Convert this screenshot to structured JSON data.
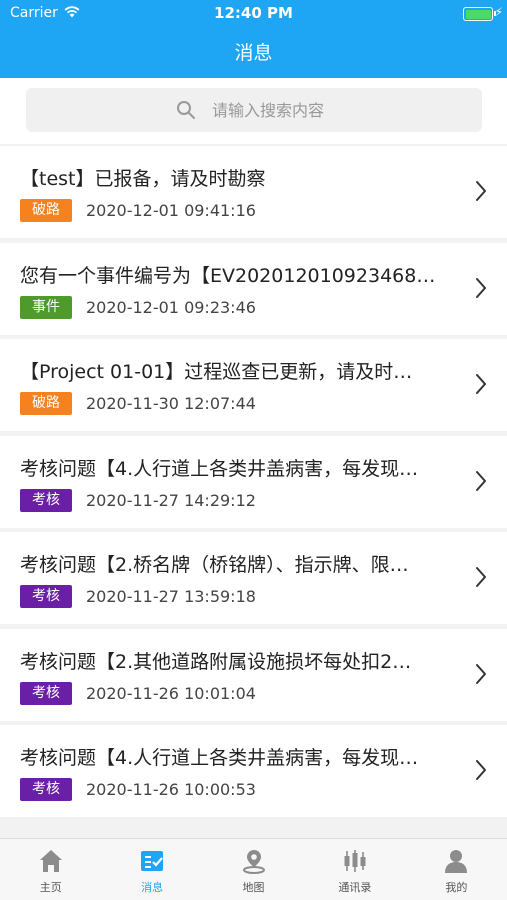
{
  "status_bar": {
    "carrier": "Carrier",
    "time": "12:40 PM"
  },
  "header": {
    "title": "消息"
  },
  "search": {
    "placeholder": "请输入搜索内容"
  },
  "messages": [
    {
      "title": "【test】已报备，请及时勘察",
      "tag": "破路",
      "tag_color": "#f5821f",
      "time": "2020-12-01 09:41:16"
    },
    {
      "title": "您有一个事件编号为【EV202012010923468…",
      "tag": "事件",
      "tag_color": "#4e9a2c",
      "time": "2020-12-01 09:23:46"
    },
    {
      "title": "【Project 01-01】过程巡查已更新，请及时…",
      "tag": "破路",
      "tag_color": "#f5821f",
      "time": "2020-11-30 12:07:44"
    },
    {
      "title": "考核问题【4.人行道上各类井盖病害，每发现…",
      "tag": "考核",
      "tag_color": "#6a1fa6",
      "time": "2020-11-27 14:29:12"
    },
    {
      "title": "考核问题【2.桥名牌（桥铭牌）、指示牌、限…",
      "tag": "考核",
      "tag_color": "#6a1fa6",
      "time": "2020-11-27 13:59:18"
    },
    {
      "title": "考核问题【2.其他道路附属设施损坏每处扣2…",
      "tag": "考核",
      "tag_color": "#6a1fa6",
      "time": "2020-11-26 10:01:04"
    },
    {
      "title": "考核问题【4.人行道上各类井盖病害，每发现…",
      "tag": "考核",
      "tag_color": "#6a1fa6",
      "time": "2020-11-26 10:00:53"
    }
  ],
  "tabbar": {
    "items": [
      {
        "label": "主页",
        "icon": "home-icon"
      },
      {
        "label": "消息",
        "icon": "message-icon",
        "active": true
      },
      {
        "label": "地图",
        "icon": "map-pin-icon"
      },
      {
        "label": "通讯录",
        "icon": "contacts-icon"
      },
      {
        "label": "我的",
        "icon": "user-icon"
      }
    ]
  },
  "colors": {
    "primary": "#1ea5f3",
    "inactive_icon": "#8c8c8c"
  }
}
